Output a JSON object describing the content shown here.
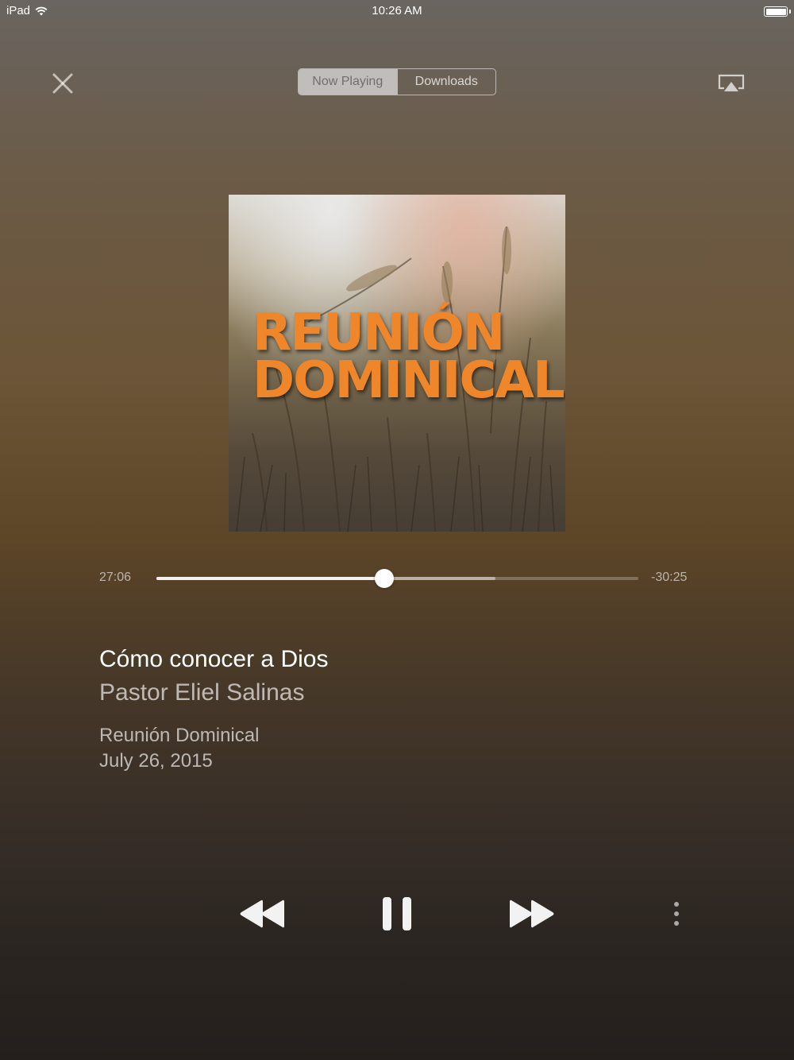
{
  "status_bar": {
    "device": "iPad",
    "time": "10:26 AM",
    "icons": [
      "wifi-icon",
      "battery-icon"
    ]
  },
  "header": {
    "close_icon": "close-icon",
    "tabs": [
      {
        "label": "Now Playing",
        "active": true
      },
      {
        "label": "Downloads",
        "active": false
      }
    ],
    "airplay_icon": "airplay-icon"
  },
  "artwork": {
    "line1": "REUNIÓN",
    "line2": "DOMINICAL",
    "text_color": "#f0862a"
  },
  "player": {
    "elapsed": "27:06",
    "remaining": "-30:25",
    "progress_fraction": 0.473,
    "buffered_fraction": 0.703
  },
  "track": {
    "title": "Cómo conocer a Dios",
    "speaker": "Pastor Eliel Salinas",
    "series": "Reunión Dominical",
    "date": "July 26, 2015"
  },
  "controls": {
    "icons": [
      "rewind-icon",
      "pause-icon",
      "fast-forward-icon",
      "more-icon"
    ]
  }
}
